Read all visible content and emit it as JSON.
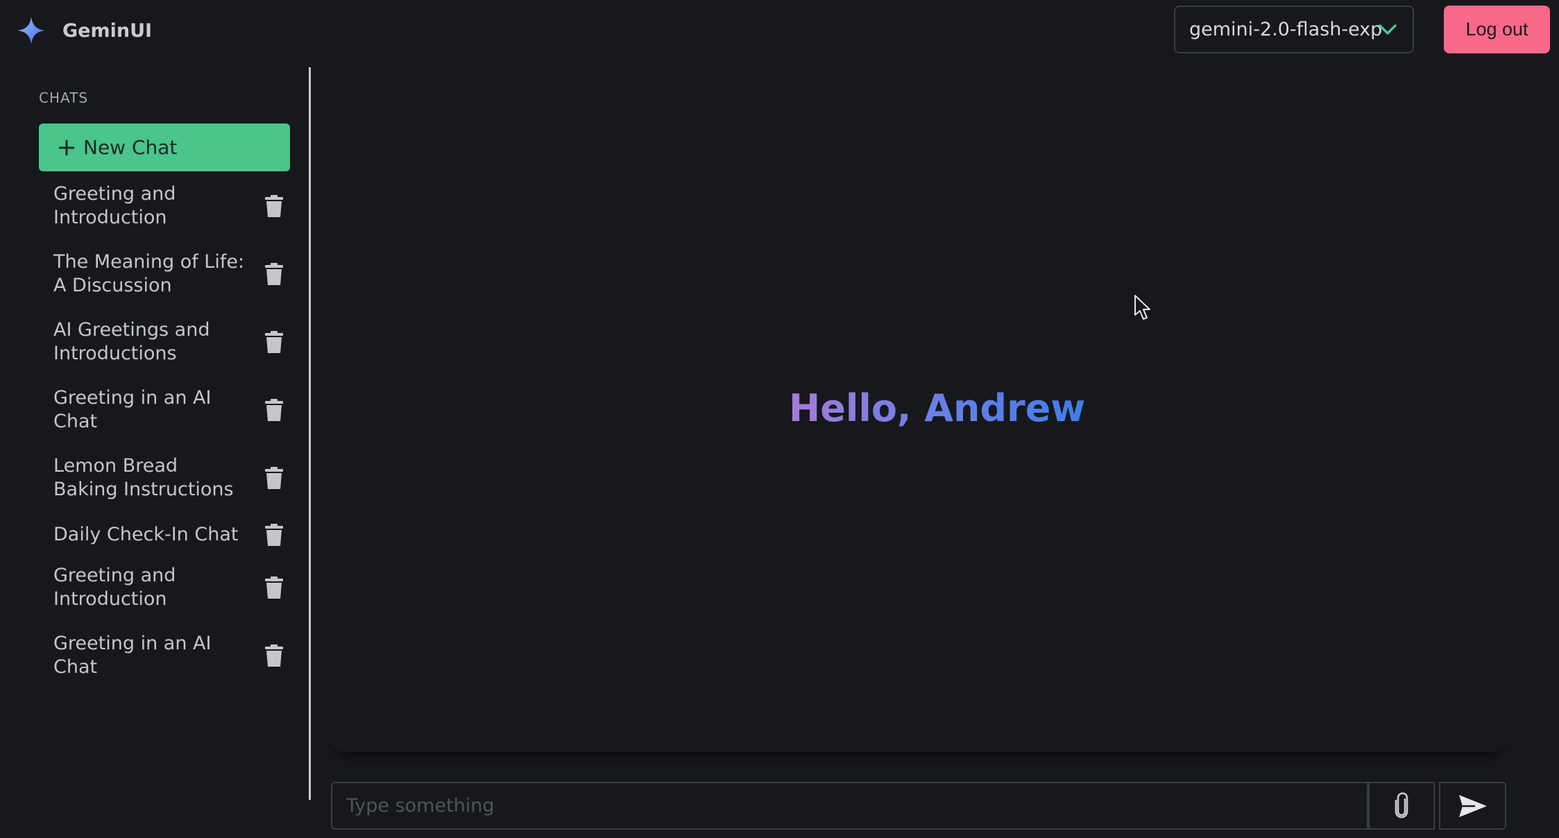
{
  "app": {
    "name": "GeminUI",
    "logo_icon": "sparkle-icon",
    "accent_color": "#4ac58c",
    "danger_color": "#f8698a"
  },
  "header": {
    "model_select": {
      "value": "gemini-2.0-flash-exp",
      "icon": "chevron-down-icon"
    },
    "logout_label": "Log out"
  },
  "sidebar": {
    "heading": "CHATS",
    "new_chat_label": "New Chat",
    "chats": [
      {
        "title": "Greeting and Introduction"
      },
      {
        "title": "The Meaning of Life: A Discussion"
      },
      {
        "title": "AI Greetings and Introductions"
      },
      {
        "title": "Greeting in an AI Chat"
      },
      {
        "title": "Lemon Bread Baking Instructions"
      },
      {
        "title": "Daily Check-In Chat"
      },
      {
        "title": "Greeting and Introduction"
      },
      {
        "title": "Greeting in an AI Chat"
      }
    ]
  },
  "main": {
    "greeting": "Hello, Andrew"
  },
  "composer": {
    "placeholder": "Type something",
    "attach_icon": "paperclip-icon",
    "send_icon": "send-icon"
  }
}
